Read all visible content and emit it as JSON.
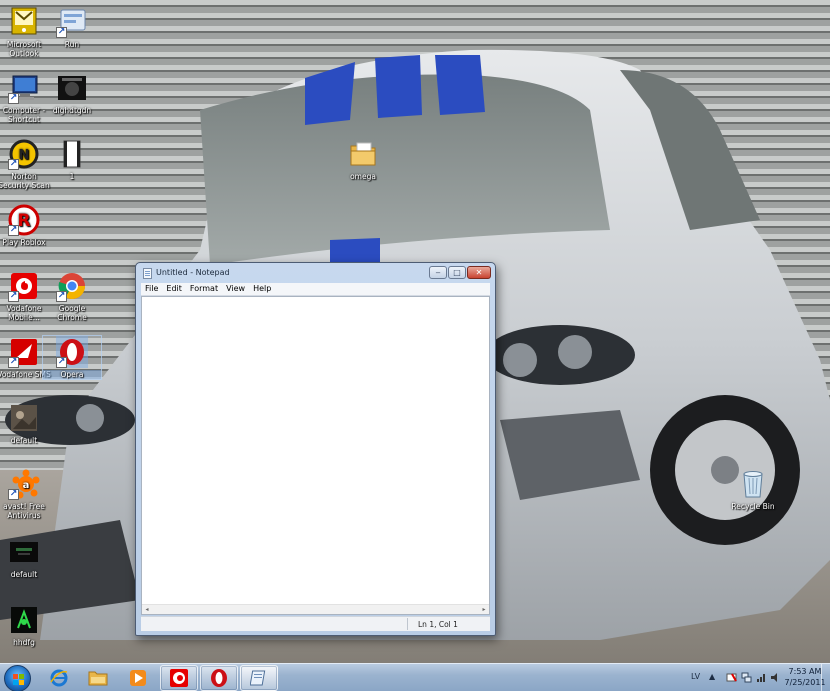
{
  "desktop": {
    "icons": [
      {
        "id": "outlook",
        "label": "Microsoft Outlook",
        "icon": "outlook-icon"
      },
      {
        "id": "run",
        "label": "Run",
        "icon": "run-icon"
      },
      {
        "id": "computer",
        "label": "Computer - Shortcut",
        "icon": "computer-icon"
      },
      {
        "id": "dlghdtgdn",
        "label": "dlghdtgdn",
        "icon": "hacker-image-icon"
      },
      {
        "id": "norton",
        "label": "Norton Security Scan",
        "icon": "norton-icon"
      },
      {
        "id": "one",
        "label": "1",
        "icon": "film-strip-icon"
      },
      {
        "id": "roblox",
        "label": "Play Roblox",
        "icon": "roblox-icon"
      },
      {
        "id": "vodafone-mobile",
        "label": "Vodafone Mobile...",
        "icon": "vodafone-icon"
      },
      {
        "id": "chrome",
        "label": "Google Chrome",
        "icon": "chrome-icon"
      },
      {
        "id": "vodafone-sms",
        "label": "Vodafone SMS",
        "icon": "vodafone-sms-icon"
      },
      {
        "id": "opera",
        "label": "Opera",
        "icon": "opera-icon"
      },
      {
        "id": "default1",
        "label": "default",
        "icon": "image-file-icon"
      },
      {
        "id": "avast",
        "label": "avast! Free Antivirus",
        "icon": "avast-icon"
      },
      {
        "id": "default2",
        "label": "default",
        "icon": "hacker-image-icon"
      },
      {
        "id": "hhdfg",
        "label": "hhdfg",
        "icon": "green-image-icon"
      },
      {
        "id": "omega",
        "label": "omega",
        "icon": "folder-icon"
      },
      {
        "id": "recycle",
        "label": "Recycle Bin",
        "icon": "recycle-bin-icon"
      }
    ]
  },
  "notepad": {
    "title": "Untitled - Notepad",
    "menu": [
      "File",
      "Edit",
      "Format",
      "View",
      "Help"
    ],
    "content": "",
    "status_position": "Ln 1, Col 1",
    "buttons": {
      "minimize": "‒",
      "maximize": "□",
      "close": "✕"
    }
  },
  "taskbar": {
    "pinned": [
      "internet-explorer-icon",
      "windows-explorer-icon",
      "media-player-icon",
      "vodafone-icon",
      "opera-icon",
      "notepad-icon"
    ],
    "language": "LV",
    "time": "7:53 AM",
    "date": "7/25/2011"
  },
  "colors": {
    "vodafone_red": "#e60000",
    "opera_red": "#cc0f16",
    "taskbar": "#9bb3cf"
  }
}
